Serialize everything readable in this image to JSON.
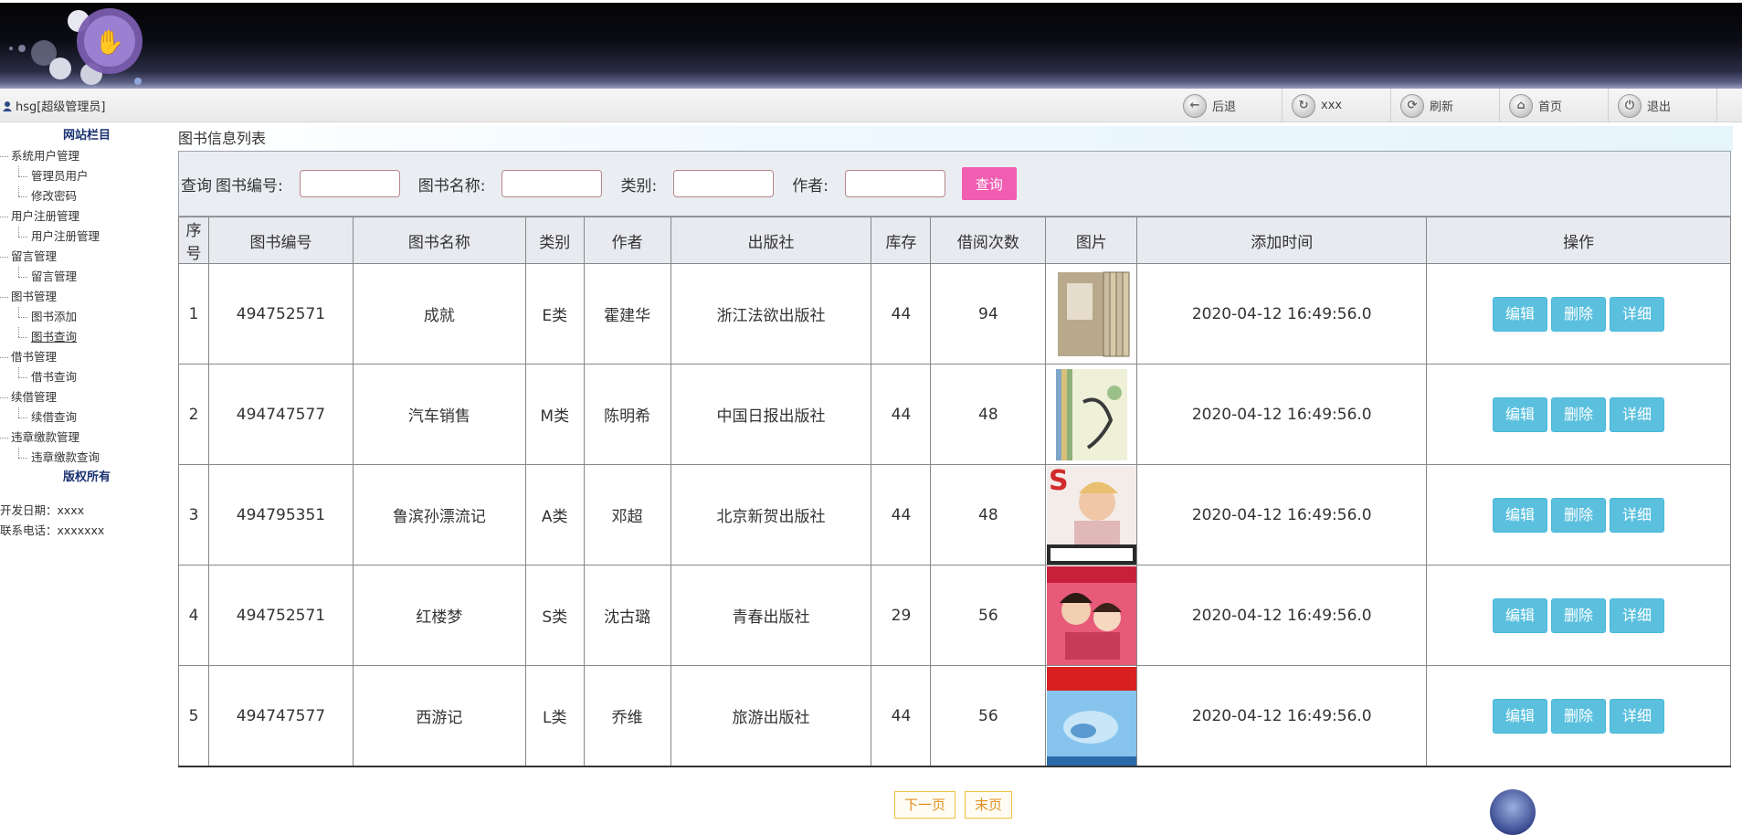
{
  "header": {
    "user_label": "hsg[超级管理员]",
    "toolbar": [
      {
        "label": "后退",
        "icon": "back-arrow-icon",
        "glyph": "←"
      },
      {
        "label": "xxx",
        "icon": "refresh-circle-icon",
        "glyph": "↻"
      },
      {
        "label": "刷新",
        "icon": "refresh-icon",
        "glyph": "⟳"
      },
      {
        "label": "首页",
        "icon": "home-icon",
        "glyph": "⌂"
      },
      {
        "label": "退出",
        "icon": "power-icon",
        "glyph": "⏻"
      }
    ]
  },
  "sidebar": {
    "title": "网站栏目",
    "groups": [
      {
        "label": "系统用户管理",
        "children": [
          "管理员用户",
          "修改密码"
        ]
      },
      {
        "label": "用户注册管理",
        "children": [
          "用户注册管理"
        ]
      },
      {
        "label": "留言管理",
        "children": [
          "留言管理"
        ]
      },
      {
        "label": "图书管理",
        "children": [
          "图书添加",
          "图书查询"
        ]
      },
      {
        "label": "借书管理",
        "children": [
          "借书查询"
        ]
      },
      {
        "label": "续借管理",
        "children": [
          "续借查询"
        ]
      },
      {
        "label": "违章缴款管理",
        "children": [
          "违章缴款查询"
        ]
      }
    ],
    "footer_title": "版权所有",
    "dev_date": "开发日期：xxxx",
    "phone": "联系电话：xxxxxxx"
  },
  "main": {
    "title": "图书信息列表",
    "search": {
      "query_label": "查询",
      "book_no_label": "图书编号:",
      "book_name_label": "图书名称:",
      "category_label": "类别:",
      "author_label": "作者:",
      "button": "查询"
    },
    "columns": [
      "序号",
      "图书编号",
      "图书名称",
      "类别",
      "作者",
      "出版社",
      "库存",
      "借阅次数",
      "图片",
      "添加时间",
      "操作"
    ],
    "rows": [
      {
        "index": "1",
        "book_no": "494752571",
        "name": "成就",
        "category": "E类",
        "author": "霍建华",
        "publisher": "浙江法欲出版社",
        "stock": "44",
        "borrow_count": "94",
        "image": "book-box-set",
        "added": "2020-04-12 16:49:56.0"
      },
      {
        "index": "2",
        "book_no": "494747577",
        "name": "汽车销售",
        "category": "M类",
        "author": "陈明希",
        "publisher": "中国日报出版社",
        "stock": "44",
        "borrow_count": "48",
        "image": "shiji-book-set",
        "added": "2020-04-12 16:49:56.0"
      },
      {
        "index": "3",
        "book_no": "494795351",
        "name": "鲁滨孙漂流记",
        "category": "A类",
        "author": "邓超",
        "publisher": "北京新贺出版社",
        "stock": "44",
        "borrow_count": "48",
        "image": "fashion-magazine",
        "added": "2020-04-12 16:49:56.0"
      },
      {
        "index": "4",
        "book_no": "494752571",
        "name": "红楼梦",
        "category": "S类",
        "author": "沈古璐",
        "publisher": "青春出版社",
        "stock": "29",
        "borrow_count": "56",
        "image": "couple-magazine",
        "added": "2020-04-12 16:49:56.0"
      },
      {
        "index": "5",
        "book_no": "494747577",
        "name": "西游记",
        "category": "L类",
        "author": "乔维",
        "publisher": "旅游出版社",
        "stock": "44",
        "borrow_count": "56",
        "image": "knowledge-economy-magazine",
        "added": "2020-04-12 16:49:56.0"
      }
    ],
    "actions": {
      "edit": "编辑",
      "delete": "删除",
      "detail": "详细"
    },
    "pager": {
      "next": "下一页",
      "last": "末页"
    }
  },
  "colors": {
    "search_button": "#f15db0",
    "action_button": "#5bc0de",
    "pager_border": "#f0c040",
    "sidebar_heading": "#1a3270"
  }
}
